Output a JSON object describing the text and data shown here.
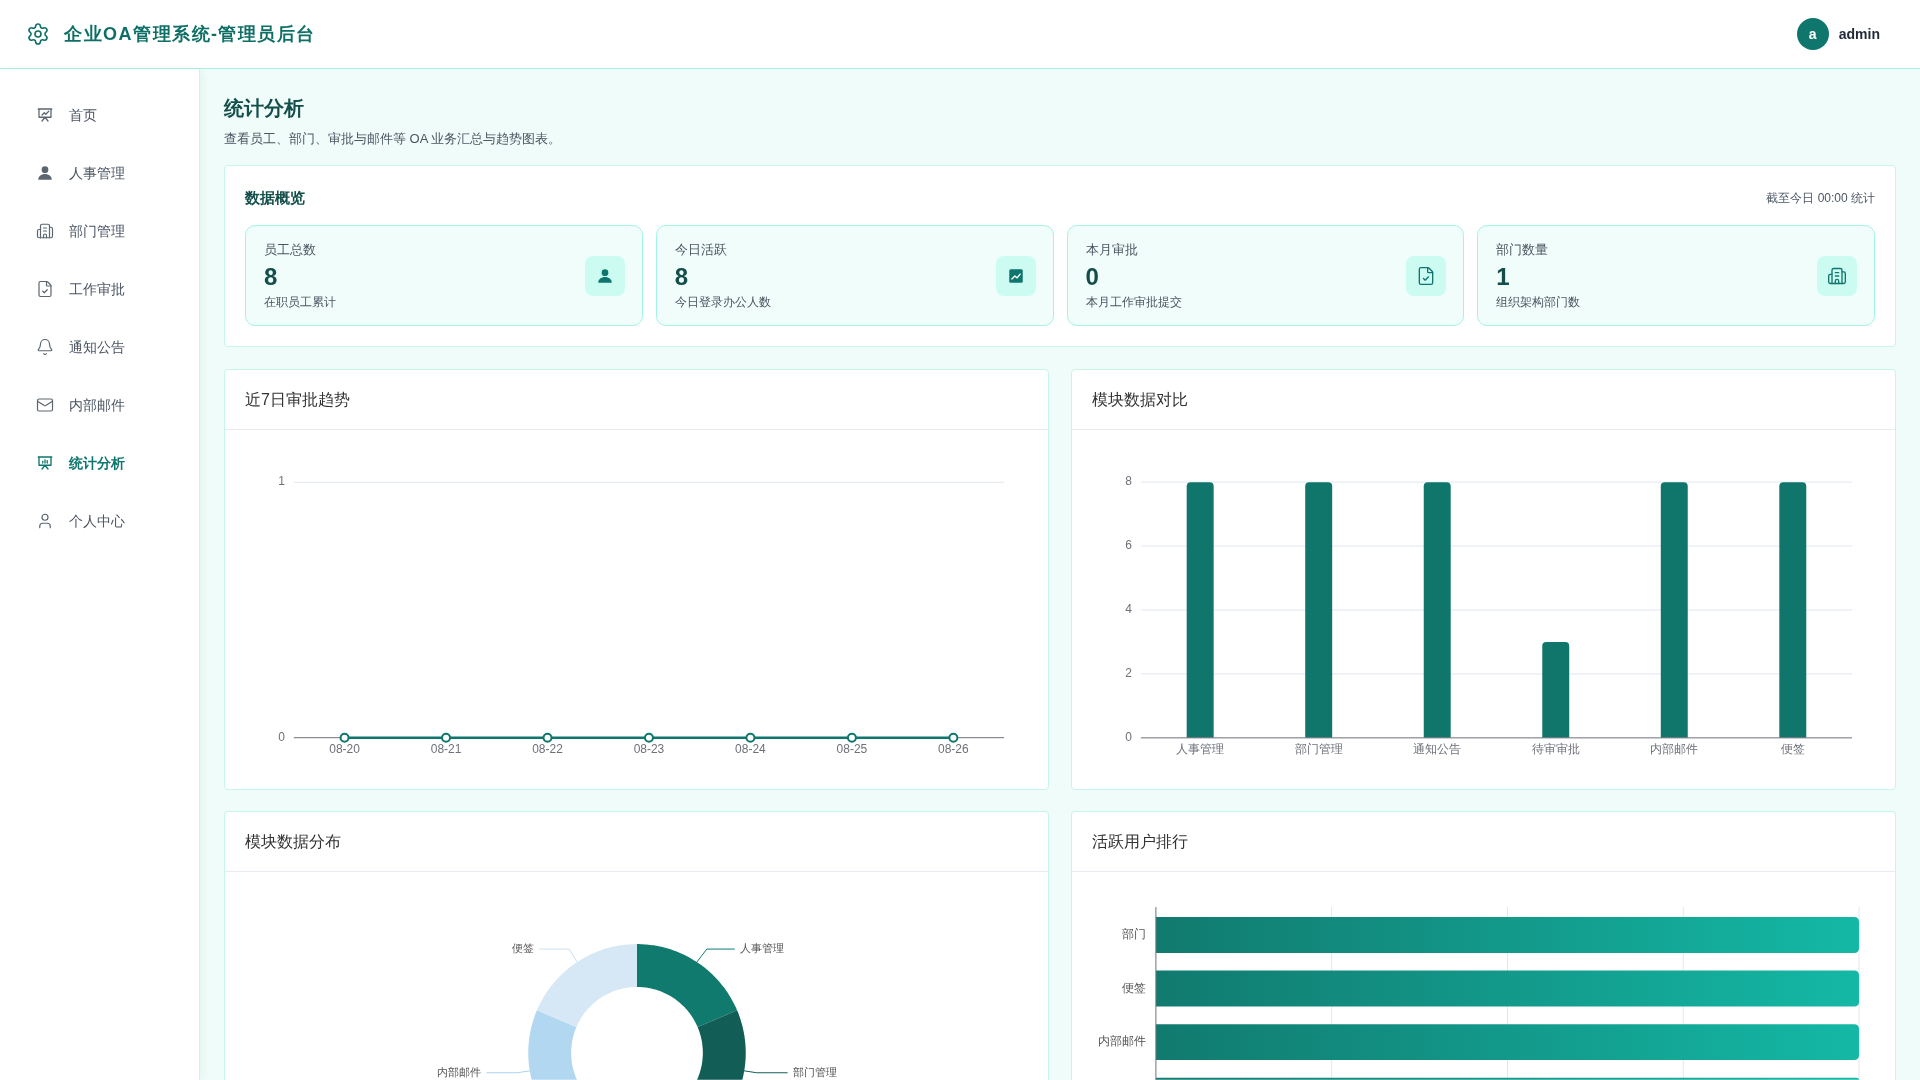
{
  "header": {
    "title": "企业OA管理系统-管理员后台",
    "user": {
      "avatar": "a",
      "name": "admin"
    }
  },
  "sidebar": {
    "items": [
      {
        "label": "首页",
        "selected": false
      },
      {
        "label": "人事管理",
        "selected": false
      },
      {
        "label": "部门管理",
        "selected": false
      },
      {
        "label": "工作审批",
        "selected": false
      },
      {
        "label": "通知公告",
        "selected": false
      },
      {
        "label": "内部邮件",
        "selected": false
      },
      {
        "label": "统计分析",
        "selected": true
      },
      {
        "label": "个人中心",
        "selected": false
      }
    ]
  },
  "page": {
    "title": "统计分析",
    "subtitle": "查看员工、部门、审批与邮件等 OA 业务汇总与趋势图表。"
  },
  "overview": {
    "title": "数据概览",
    "note": "截至今日 00:00 统计",
    "stats": [
      {
        "label": "员工总数",
        "value": "8",
        "caption": "在职员工累计"
      },
      {
        "label": "今日活跃",
        "value": "8",
        "caption": "今日登录办公人数"
      },
      {
        "label": "本月审批",
        "value": "0",
        "caption": "本月工作审批提交"
      },
      {
        "label": "部门数量",
        "value": "1",
        "caption": "组织架构部门数"
      }
    ]
  },
  "approval_trend": {
    "title": "近7日审批趋势",
    "chart_data": {
      "type": "line",
      "categories": [
        "08-20",
        "08-21",
        "08-22",
        "08-23",
        "08-24",
        "08-25",
        "08-26"
      ],
      "values": [
        0,
        0,
        0,
        0,
        0,
        0,
        0
      ],
      "ylim": [
        0,
        1
      ],
      "yticks": [
        0,
        1
      ],
      "marker": true,
      "grid": true
    }
  },
  "module_comparison": {
    "title": "模块数据对比",
    "chart_data": {
      "type": "bar",
      "categories": [
        "人事管理",
        "部门管理",
        "通知公告",
        "待审审批",
        "内部邮件",
        "便签"
      ],
      "values": [
        8,
        8,
        8,
        3,
        8,
        8
      ],
      "ylim": [
        0,
        8
      ],
      "yticks": [
        0,
        2,
        4,
        6,
        8
      ],
      "grid": true
    }
  },
  "module_distribution": {
    "title": "模块数据分布",
    "slice_labels": [
      "人事管理",
      "部门管理",
      "内部邮件",
      "便签"
    ]
  },
  "active_user_ranking": {
    "title": "活跃用户排行",
    "labels": [
      "部门",
      "便签",
      "内部邮件"
    ]
  }
}
